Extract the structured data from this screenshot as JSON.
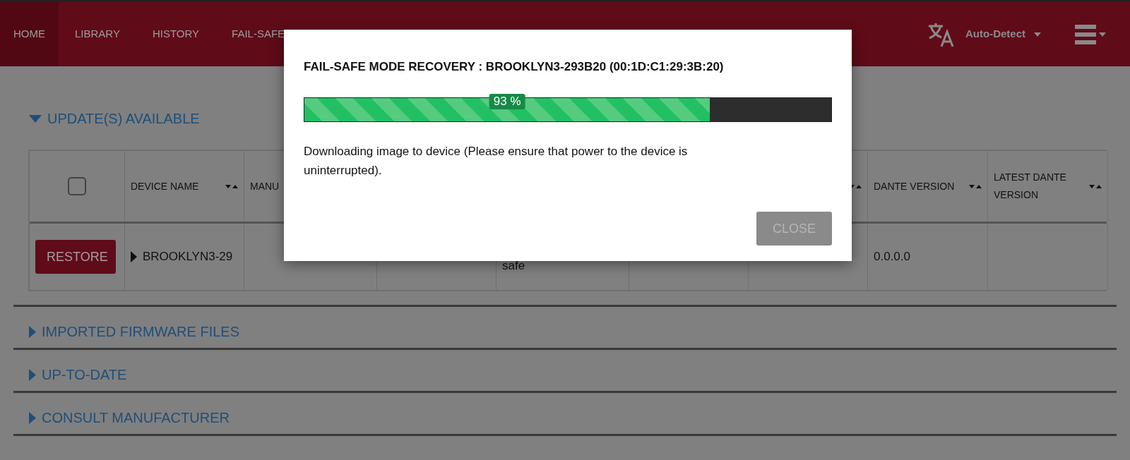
{
  "nav": {
    "tabs": [
      {
        "label": "HOME",
        "selected": true
      },
      {
        "label": "LIBRARY",
        "selected": false
      },
      {
        "label": "HISTORY",
        "selected": false
      },
      {
        "label": "FAIL-SAFE",
        "selected": false
      }
    ],
    "language": "Auto-Detect"
  },
  "sections": [
    {
      "title": "UPDATE(S) AVAILABLE",
      "expanded": true
    },
    {
      "title": "IMPORTED FIRMWARE FILES",
      "expanded": false
    },
    {
      "title": "UP-TO-DATE",
      "expanded": false
    },
    {
      "title": "CONSULT MANUFACTURER",
      "expanded": false
    }
  ],
  "table": {
    "columns": [
      {
        "kind": "select",
        "checked": false
      },
      {
        "kind": "sortable",
        "label": "DEVICE NAME"
      },
      {
        "kind": "label",
        "label": "MANU"
      },
      {
        "kind": "blank"
      },
      {
        "kind": "blank"
      },
      {
        "kind": "blank"
      },
      {
        "kind": "sortable"
      },
      {
        "kind": "sortable",
        "label": "DANTE VERSION"
      },
      {
        "kind": "sortable",
        "label": "LATEST DANTE VERSION"
      }
    ],
    "rows": [
      {
        "cells": [
          {
            "kind": "button",
            "text": "RESTORE"
          },
          {
            "kind": "expander",
            "text": "BROOKLYN3-29"
          },
          {
            "kind": "blank"
          },
          {
            "kind": "blank"
          },
          {
            "kind": "low_text",
            "text": "safe"
          },
          {
            "kind": "blank"
          },
          {
            "kind": "blank"
          },
          {
            "kind": "text",
            "text": "0.0.0.0"
          },
          {
            "kind": "blank"
          }
        ]
      }
    ]
  },
  "dialog": {
    "title": "FAIL-SAFE MODE RECOVERY : BROOKLYN3-293B20 (00:1D:C1:29:3B:20)",
    "progress": {
      "level": 0.77,
      "reading": "93 %"
    },
    "message": "Downloading image to device (Please ensure that power to the device is uninterrupted).",
    "buttons": [
      {
        "label": "CLOSE",
        "disabled": true
      }
    ]
  }
}
